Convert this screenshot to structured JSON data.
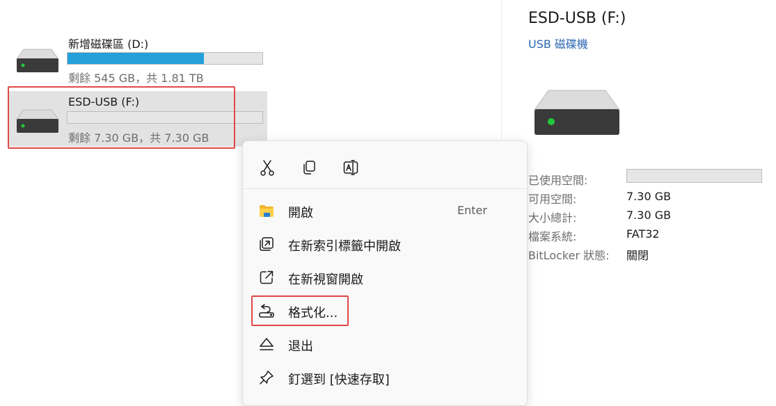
{
  "drives": [
    {
      "name": "新增磁碟區 (D:)",
      "sub": "剩餘 545 GB，共 1.81 TB",
      "used_fraction": 0.7
    },
    {
      "name": "ESD-USB (F:)",
      "sub": "剩餘 7.30 GB，共 7.30 GB",
      "used_fraction": 0.0
    }
  ],
  "details": {
    "title": "ESD-USB (F:)",
    "subtitle": "USB 磁碟機",
    "used_label": "已使用空間:",
    "used_fraction": 0.0,
    "free_label": "可用空間:",
    "free_value": "7.30 GB",
    "total_label": "大小總計:",
    "total_value": "7.30 GB",
    "fs_label": "檔案系統:",
    "fs_value": "FAT32",
    "bitlocker_label": "BitLocker 狀態:",
    "bitlocker_value": "關閉"
  },
  "context_menu": {
    "quick_actions": [
      "cut-icon",
      "copy-icon",
      "rename-icon"
    ],
    "items": [
      {
        "label": "開啟",
        "shortcut": "Enter",
        "icon": "folder-icon"
      },
      {
        "label": "在新索引標籤中開啟",
        "icon": "open-in-new-tab-icon"
      },
      {
        "label": "在新視窗開啟",
        "icon": "open-in-new-window-icon"
      },
      {
        "label": "格式化...",
        "icon": "format-icon"
      },
      {
        "label": "退出",
        "icon": "eject-icon"
      },
      {
        "label": "釘選到 [快速存取]",
        "icon": "pin-icon"
      }
    ]
  },
  "colors": {
    "accent": "#26a0da",
    "highlight": "#e04848",
    "selection": "#e2e2e2"
  }
}
